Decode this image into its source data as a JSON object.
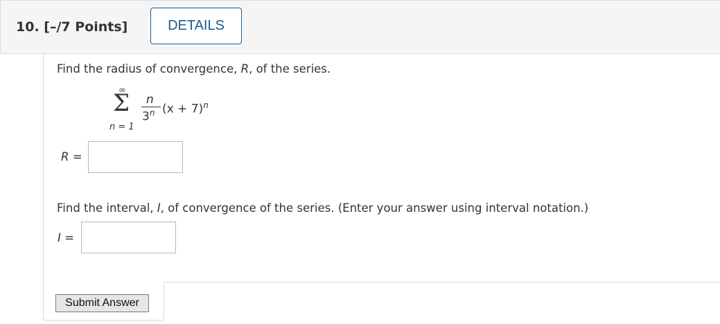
{
  "question": {
    "number": "10.",
    "points": "[–/7 Points]",
    "details_label": "DETAILS"
  },
  "part1": {
    "prompt_before": "Find the radius of convergence, ",
    "prompt_var": "R",
    "prompt_after": ", of the series.",
    "series": {
      "sigma": "Σ",
      "upper": "∞",
      "lower": "n = 1",
      "numerator": "n",
      "denominator_base": "3",
      "denominator_exp": "n",
      "term": "(x + 7)",
      "term_exp": "n"
    },
    "answer_label_var": "R",
    "answer_label_eq": " =",
    "answer_value": ""
  },
  "part2": {
    "prompt_before": "Find the interval, ",
    "prompt_var": "I",
    "prompt_after": ", of convergence of the series. (Enter your answer using interval notation.)",
    "answer_label_var": "I",
    "answer_label_eq": " =",
    "answer_value": ""
  },
  "submit_label": "Submit Answer",
  "colors": {
    "accent": "#1d5a8e",
    "header_bg": "#f5f5f5",
    "text": "#333333"
  }
}
